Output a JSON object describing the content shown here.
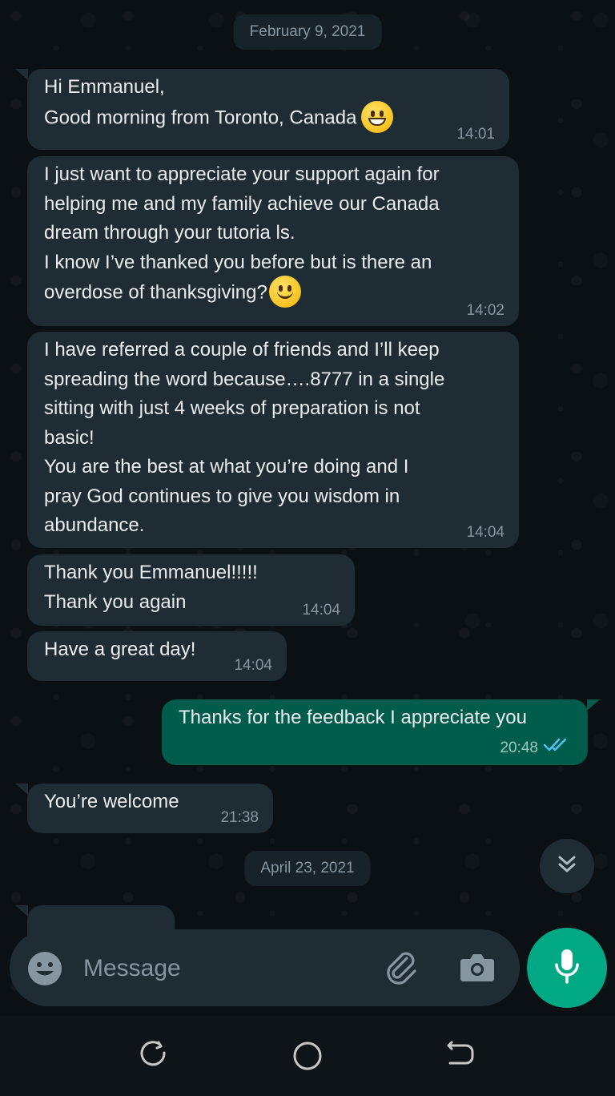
{
  "chat": {
    "date_pills": [
      "February 9, 2021",
      "April 23, 2021"
    ],
    "messages": [
      {
        "direction": "in",
        "lines": [
          "Hi Emmanuel,",
          "Good morning from Toronto, Canada"
        ],
        "emoji": "grinning-face",
        "time": "14:01"
      },
      {
        "direction": "in",
        "lines": [
          "I just want to appreciate your support again for",
          "helping me and my family achieve our Canada",
          "dream through your tutoria ls.",
          "I know I’ve thanked you before but is there an",
          "overdose of thanksgiving?"
        ],
        "emoji": "slightly-smiling-face",
        "time": "14:02"
      },
      {
        "direction": "in",
        "lines": [
          "I have referred a couple of friends and I’ll keep",
          "spreading the word because….8777 in a single",
          "sitting with just 4 weeks of preparation is not",
          "basic!",
          "You are the best at what you’re doing and I",
          "pray God continues to give you wisdom in",
          "abundance."
        ],
        "time": "14:04"
      },
      {
        "direction": "in",
        "lines": [
          "Thank you Emmanuel!!!!!",
          "Thank you again"
        ],
        "time": "14:04"
      },
      {
        "direction": "in",
        "lines": [
          "Have a great day!"
        ],
        "time": "14:04"
      },
      {
        "direction": "out",
        "lines": [
          "Thanks for the feedback I appreciate you"
        ],
        "time": "20:48",
        "status": "read-double-check-icon"
      },
      {
        "direction": "in",
        "lines": [
          "You’re welcome"
        ],
        "time": "21:38"
      }
    ]
  },
  "composer": {
    "placeholder": "Message",
    "icons": [
      "emoji-icon",
      "paperclip-icon",
      "camera-icon",
      "microphone-icon"
    ]
  },
  "colors": {
    "background": "#0b1014",
    "incoming_bubble": "#202c33",
    "outgoing_bubble": "#005c4b",
    "accent": "#00a884",
    "read_ticks": "#53bdeb",
    "meta_text": "#8696a0"
  }
}
